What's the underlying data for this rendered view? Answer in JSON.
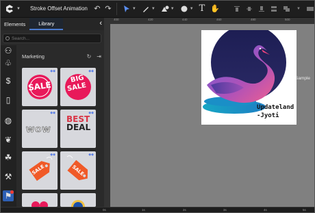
{
  "app": {
    "title": "Stroke Offset Animation"
  },
  "toolbar": {
    "undo_icon": "undo-icon",
    "redo_icon": "redo-icon",
    "tools": [
      "selection-tool",
      "pen-tool",
      "shape-tool",
      "color-tool",
      "text-tool",
      "hand-tool"
    ],
    "align_tools": [
      "align-top",
      "align-middle",
      "align-bottom",
      "distribute",
      "group",
      "arrange"
    ]
  },
  "left_panel": {
    "tabs": [
      {
        "label": "Elements",
        "active": false
      },
      {
        "label": "Library",
        "active": true
      }
    ],
    "search_placeholder": "Search...",
    "category": {
      "title": "Marketing"
    },
    "items": [
      {
        "name": "sale-sticker",
        "text": "SALE"
      },
      {
        "name": "big-sale-sticker",
        "text_top": "BIG",
        "text_bottom": "SALE"
      },
      {
        "name": "wow-sticker",
        "text": "WOW"
      },
      {
        "name": "best-deal-sticker",
        "text_top": "BEST",
        "text_bottom": "DEAL"
      },
      {
        "name": "sale-tag-1",
        "text": "SALE"
      },
      {
        "name": "sale-tag-2",
        "text": "SALE"
      }
    ]
  },
  "canvas": {
    "artboard_caption_line1": "Updateland",
    "artboard_caption_line2": "-Jyoti",
    "side_label": "Sample"
  },
  "rulers": {
    "top": [
      "400",
      "420",
      "440",
      "460",
      "480",
      "500",
      "520"
    ],
    "bottom": [
      "0s",
      "1s",
      "2s",
      "3s",
      "4s",
      "5s"
    ]
  },
  "colors": {
    "accent": "#4a7bd0",
    "sale_pink": "#e8195a",
    "tag_orange": "#f05a28",
    "swan_purple": "#7a4fb0",
    "swan_pink": "#e85a9a",
    "water_teal": "#1fb3c9",
    "moon_navy": "#1e1f4f"
  }
}
